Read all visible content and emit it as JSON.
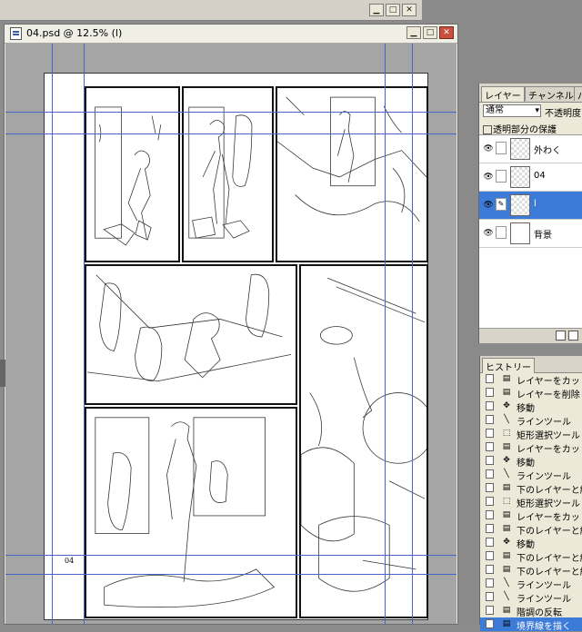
{
  "app": {
    "document_title": "04.psd @ 12.5% (l)"
  },
  "page": {
    "page_number": "04"
  },
  "layers_panel": {
    "tabs": [
      "レイヤー",
      "チャンネル",
      "パ"
    ],
    "active_tab": "レイヤー",
    "blend_mode": "通常",
    "opacity_label": "不透明度:",
    "lock_label": "透明部分の保護",
    "layers": [
      {
        "name": "外わく",
        "visible": true,
        "selected": false
      },
      {
        "name": "04",
        "visible": true,
        "selected": false
      },
      {
        "name": "l",
        "visible": true,
        "selected": true
      },
      {
        "name": "背景",
        "visible": true,
        "selected": false
      }
    ]
  },
  "history_panel": {
    "tab": "ヒストリー",
    "items": [
      {
        "label": "レイヤーをカット",
        "icon": "page-icon"
      },
      {
        "label": "レイヤーを削除",
        "icon": "page-icon"
      },
      {
        "label": "移動",
        "icon": "move-icon"
      },
      {
        "label": "ラインツール",
        "icon": "line-icon"
      },
      {
        "label": "矩形選択ツール",
        "icon": "marquee-icon"
      },
      {
        "label": "レイヤーをカット",
        "icon": "page-icon"
      },
      {
        "label": "移動",
        "icon": "move-icon"
      },
      {
        "label": "ラインツール",
        "icon": "line-icon"
      },
      {
        "label": "下のレイヤーと結合",
        "icon": "page-icon"
      },
      {
        "label": "矩形選択ツール",
        "icon": "marquee-icon"
      },
      {
        "label": "レイヤーをカット",
        "icon": "page-icon"
      },
      {
        "label": "下のレイヤーと結合",
        "icon": "page-icon"
      },
      {
        "label": "移動",
        "icon": "move-icon"
      },
      {
        "label": "下のレイヤーと結合",
        "icon": "page-icon"
      },
      {
        "label": "下のレイヤーと結合",
        "icon": "page-icon"
      },
      {
        "label": "ラインツール",
        "icon": "line-icon"
      },
      {
        "label": "ラインツール",
        "icon": "line-icon"
      },
      {
        "label": "階調の反転",
        "icon": "page-icon"
      },
      {
        "label": "境界線を描く",
        "icon": "page-icon"
      }
    ],
    "selected_index": 18
  },
  "colors": {
    "selection": "#3d7bd8",
    "guide": "#4a63c8",
    "canvas_bg": "#a5a5a5"
  }
}
